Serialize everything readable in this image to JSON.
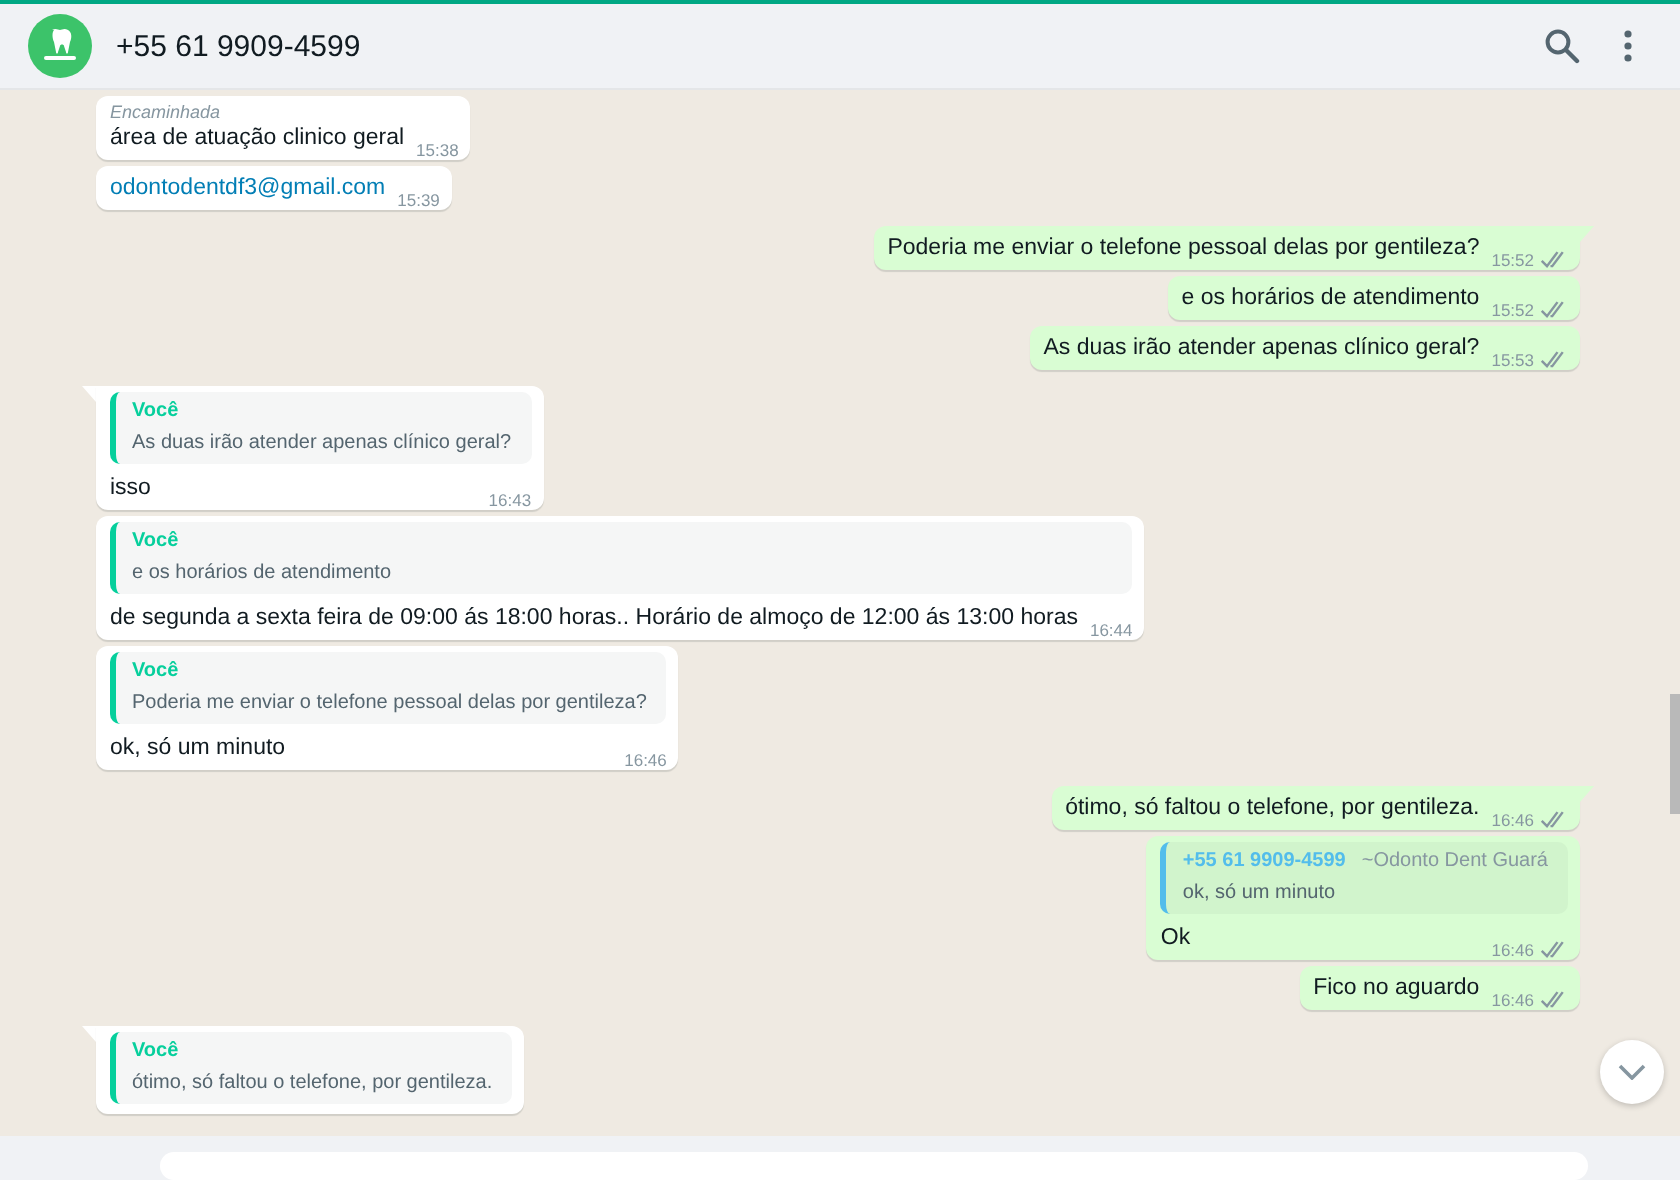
{
  "header": {
    "title": "+55 61 9909-4599"
  },
  "messages": [
    {
      "outgoing": false,
      "tail": false,
      "forwarded_label": "Encaminhada",
      "kind": "text",
      "text": "área de atuação clinico geral",
      "time": "15:38"
    },
    {
      "outgoing": false,
      "tail": false,
      "kind": "link",
      "text": "odontodentdf3@gmail.com",
      "time": "15:39"
    },
    {
      "outgoing": true,
      "tail": true,
      "kind": "text",
      "text": "Poderia me enviar o telefone pessoal delas por gentileza?",
      "time": "15:52",
      "read": false
    },
    {
      "outgoing": true,
      "tail": false,
      "kind": "text",
      "text": "e os horários de atendimento",
      "time": "15:52",
      "read": false
    },
    {
      "outgoing": true,
      "tail": false,
      "kind": "text",
      "text": "As duas irão atender apenas clínico geral?",
      "time": "15:53",
      "read": false
    },
    {
      "outgoing": false,
      "tail": true,
      "quote": {
        "author": "Você",
        "text": "As duas irão atender apenas clínico geral?",
        "color": "#06cf9c"
      },
      "kind": "text",
      "text": "isso",
      "time": "16:43"
    },
    {
      "outgoing": false,
      "tail": false,
      "quote": {
        "author": "Você",
        "text": "e os horários de atendimento",
        "color": "#06cf9c"
      },
      "kind": "text",
      "text": "de segunda a sexta feira de 09:00 ás 18:00 horas.. Horário de almoço de 12:00 ás 13:00 horas",
      "time": "16:44"
    },
    {
      "outgoing": false,
      "tail": false,
      "quote": {
        "author": "Você",
        "text": "Poderia me enviar o telefone pessoal delas por gentileza?",
        "color": "#06cf9c"
      },
      "kind": "text",
      "text": "ok, só um minuto",
      "time": "16:46"
    },
    {
      "outgoing": true,
      "tail": true,
      "kind": "text",
      "text": "ótimo, só faltou o telefone, por gentileza.",
      "time": "16:46",
      "read": false
    },
    {
      "outgoing": true,
      "tail": false,
      "quote": {
        "author": "+55 61 9909-4599",
        "author_note": "~Odonto Dent Guará",
        "text": "ok, só um minuto",
        "color": "#53bdeb"
      },
      "kind": "text",
      "text": "Ok",
      "time": "16:46",
      "read": false
    },
    {
      "outgoing": true,
      "tail": false,
      "kind": "text",
      "text": "Fico no aguardo",
      "time": "16:46",
      "read": false
    },
    {
      "outgoing": false,
      "tail": true,
      "quote": {
        "author": "Você",
        "text": "ótimo, só faltou o telefone, por gentileza.",
        "color": "#06cf9c"
      }
    }
  ]
}
